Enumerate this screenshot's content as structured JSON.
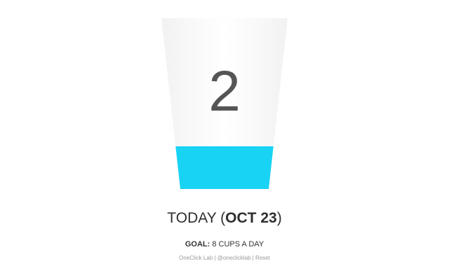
{
  "cup": {
    "count": "2",
    "fill_fraction": 0.25,
    "fill_color": "#19d3f5"
  },
  "today": {
    "prefix": "TODAY (",
    "date": "OCT 23",
    "suffix": ")"
  },
  "goal": {
    "label": "GOAL:",
    "value": " 8 CUPS A DAY"
  },
  "footer": {
    "links": [
      {
        "label": "OneClick Lab"
      },
      {
        "label": "@oneclicklab"
      },
      {
        "label": "Reset"
      }
    ],
    "separator": " | "
  }
}
